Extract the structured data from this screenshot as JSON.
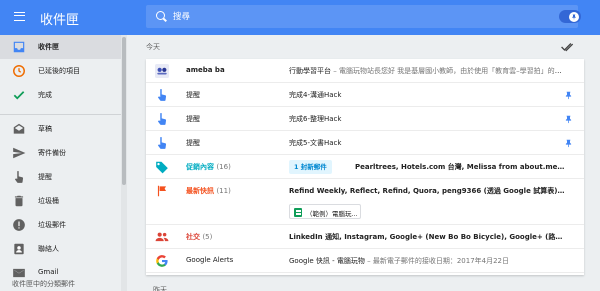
{
  "app": {
    "title": "收件匣"
  },
  "search": {
    "placeholder": "搜尋"
  },
  "colors": {
    "accent": "#4285f4",
    "reminder": "#4285f4",
    "snoozed": "#ef6c00",
    "done": "#0f9d58",
    "promotions": "#00acc1",
    "updates": "#f4511e",
    "social": "#db4437",
    "chip_bg": "#e1f5fe",
    "chip_text": "#0288d1",
    "sheets": "#0f9d58"
  },
  "sidebar": {
    "items": [
      {
        "label": "收件匣",
        "icon": "inbox-icon",
        "active": true
      },
      {
        "label": "已延後的項目",
        "icon": "clock-icon"
      },
      {
        "label": "完成",
        "icon": "check-icon"
      },
      {
        "label": "草稿",
        "icon": "drafts-icon"
      },
      {
        "label": "寄件備份",
        "icon": "send-icon"
      },
      {
        "label": "提醒",
        "icon": "reminder-hand-icon"
      },
      {
        "label": "垃圾桶",
        "icon": "trash-icon"
      },
      {
        "label": "垃圾郵件",
        "icon": "spam-icon"
      },
      {
        "label": "聯絡人",
        "icon": "contacts-icon"
      },
      {
        "label": "Gmail",
        "icon": "gmail-icon"
      }
    ],
    "footer": "收件匣中的分類郵件"
  },
  "main": {
    "section_label": "今天",
    "next_section_label": "昨天",
    "rows": [
      {
        "sender": "ameba ba",
        "subject": "行動學習平台",
        "snippet": " – 電腦玩物站長您好 我是基層國小教師，由於使用「教育雲–學習拍」的系統..."
      },
      {
        "sender": "提醒",
        "subject": "完成4-溝通Hack"
      },
      {
        "sender": "提醒",
        "subject": "完成6-整理Hack"
      },
      {
        "sender": "提醒",
        "subject": "完成5-文書Hack"
      },
      {
        "sender": "促銷內容",
        "count": "(16)",
        "chip": "1 封新郵件",
        "subject": "Pearltrees, Hotels.com 台灣, Melissa from about.me, Highly, 華南銀行, ..."
      },
      {
        "sender": "最新快訊",
        "count": "(11)",
        "subject": "Refind Weekly, Reflect, Refind, Quora, peng9366 (透過 Google 試算表), hackpad, Goo...",
        "attachment": "（範例）電腦玩..."
      },
      {
        "sender": "社交",
        "count": "(5)",
        "subject": "LinkedIn 通知, Instagram, Google+ (New Bo Bo Bicycle), Google+ (路自費), Google+ (..."
      },
      {
        "sender": "Google Alerts",
        "subject": "Google 快訊 - 電腦玩物",
        "snippet": " – 最新電子郵件的接收日期：2017年4月22日"
      }
    ]
  }
}
